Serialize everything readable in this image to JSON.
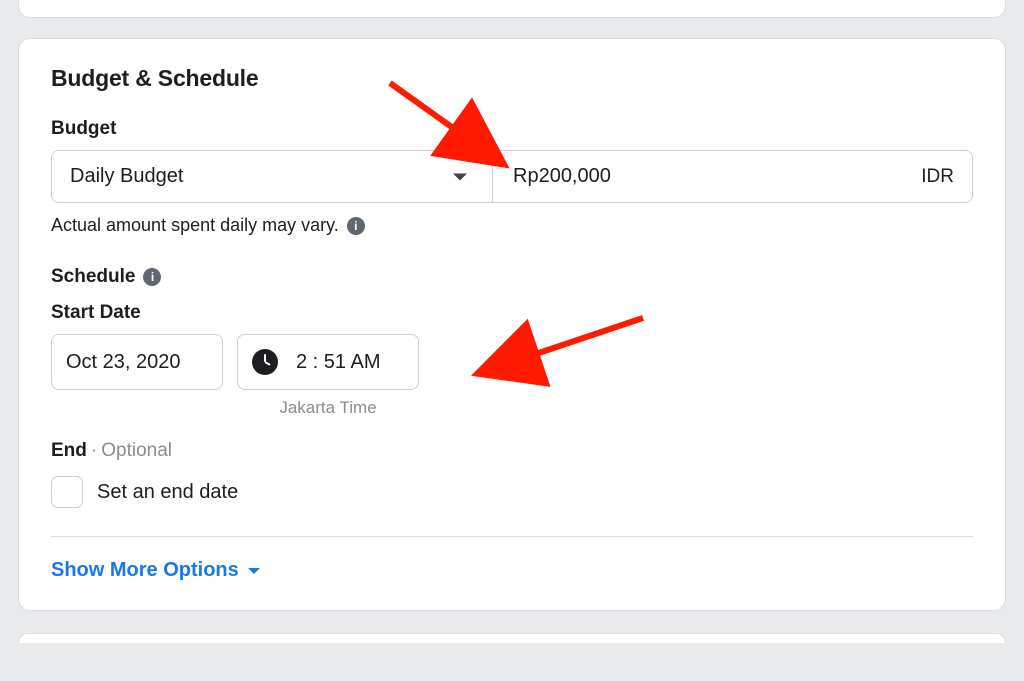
{
  "section": {
    "title": "Budget & Schedule"
  },
  "budget": {
    "label": "Budget",
    "type_selected": "Daily Budget",
    "amount": "Rp200,000",
    "currency": "IDR",
    "helper": "Actual amount spent daily may vary."
  },
  "schedule": {
    "label": "Schedule",
    "start_label": "Start Date",
    "start_date": "Oct 23, 2020",
    "start_time": "2 : 51 AM",
    "timezone": "Jakarta Time",
    "end_label": "End",
    "end_optional": "Optional",
    "set_end_label": "Set an end date"
  },
  "footer": {
    "show_more": "Show More Options"
  }
}
